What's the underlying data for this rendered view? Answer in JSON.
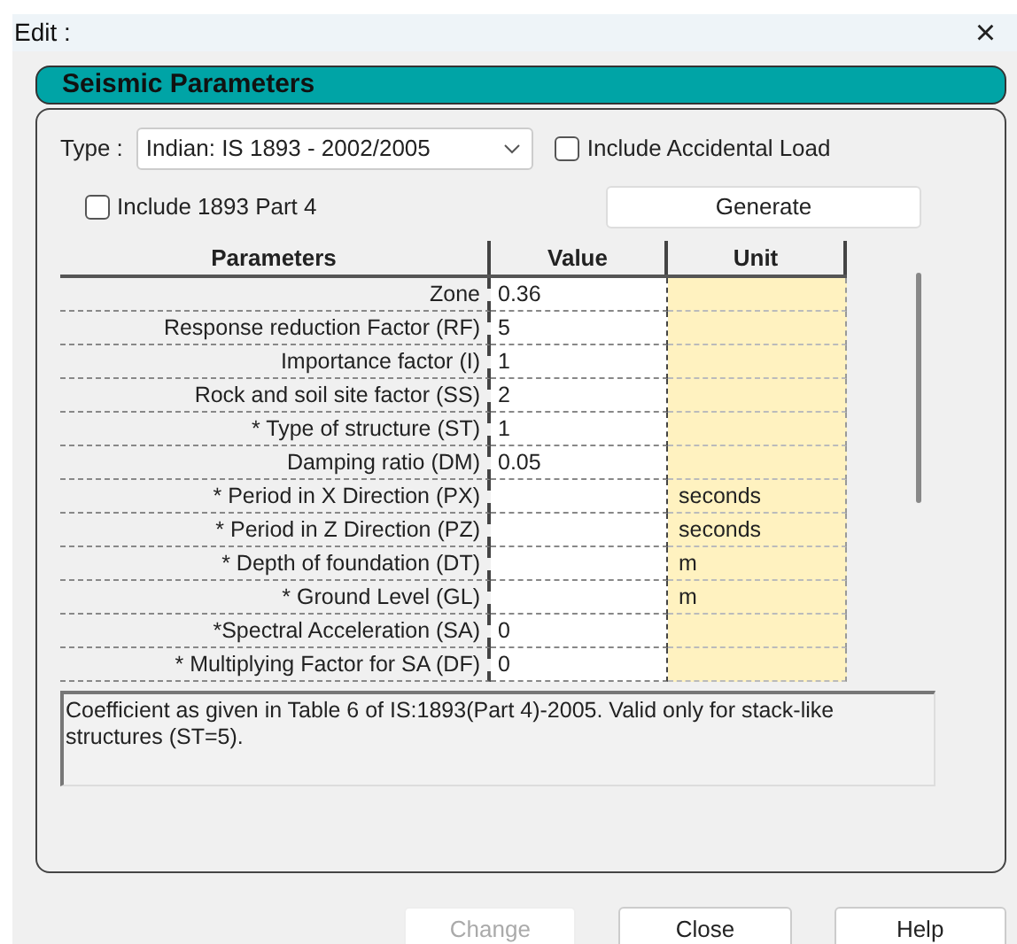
{
  "window": {
    "title": "Edit :",
    "close": "×"
  },
  "section_title": "Seismic Parameters",
  "type_label": "Type :",
  "type_value": "Indian: IS 1893 - 2002/2005",
  "include_accidental": {
    "label": "Include Accidental Load",
    "checked": false
  },
  "include_part4": {
    "label": "Include 1893 Part 4",
    "checked": false
  },
  "generate": "Generate",
  "table": {
    "columns": [
      "Parameters",
      "Value",
      "Unit"
    ],
    "rows": [
      {
        "parameter": "Zone",
        "value": "0.36",
        "unit": ""
      },
      {
        "parameter": "Response reduction Factor (RF)",
        "value": "5",
        "unit": ""
      },
      {
        "parameter": "Importance factor (I)",
        "value": "1",
        "unit": ""
      },
      {
        "parameter": "Rock and soil site factor (SS)",
        "value": "2",
        "unit": ""
      },
      {
        "parameter": "* Type of structure (ST)",
        "value": "1",
        "unit": ""
      },
      {
        "parameter": "Damping ratio (DM)",
        "value": "0.05",
        "unit": ""
      },
      {
        "parameter": "* Period in X Direction (PX)",
        "value": "",
        "unit": "seconds"
      },
      {
        "parameter": "* Period in Z Direction (PZ)",
        "value": "",
        "unit": "seconds"
      },
      {
        "parameter": "* Depth of foundation (DT)",
        "value": "",
        "unit": "m"
      },
      {
        "parameter": "* Ground Level (GL)",
        "value": "",
        "unit": "m"
      },
      {
        "parameter": "*Spectral Acceleration (SA)",
        "value": "0",
        "unit": ""
      },
      {
        "parameter": "* Multiplying Factor for SA (DF)",
        "value": "0",
        "unit": ""
      }
    ]
  },
  "description": "Coefficient as given in Table 6 of IS:1893(Part 4)-2005. Valid only for stack-like structures (ST=5).",
  "buttons": [
    {
      "label": "Change",
      "disabled": true
    },
    {
      "label": "Close",
      "disabled": false
    },
    {
      "label": "Help",
      "disabled": false
    }
  ]
}
